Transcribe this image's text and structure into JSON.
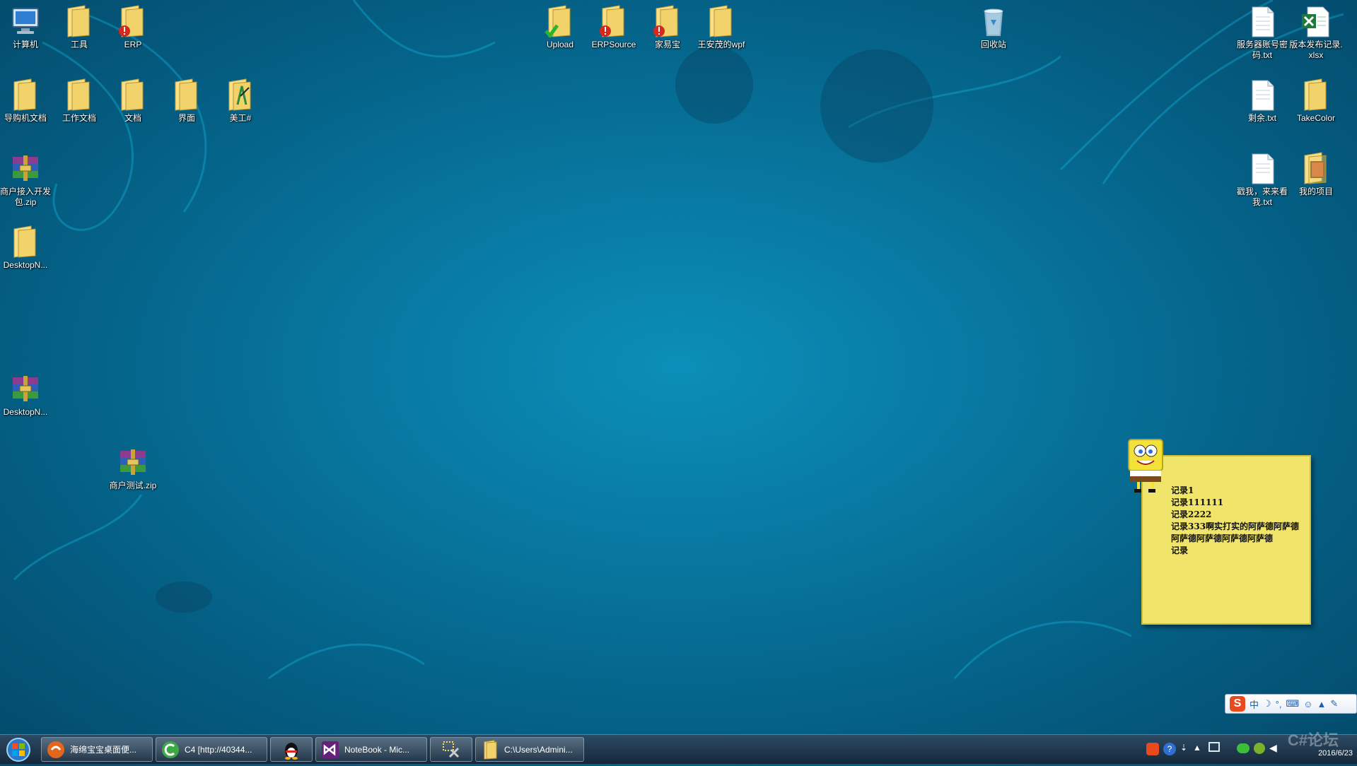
{
  "desktop": {
    "icons": [
      {
        "name": "icon-computer",
        "label": "计算机",
        "glyph": "computer-icon"
      },
      {
        "name": "icon-tools",
        "label": "工具",
        "glyph": "folder-icon"
      },
      {
        "name": "icon-erp",
        "label": "ERP",
        "glyph": "folder-error-icon"
      },
      {
        "name": "icon-upload",
        "label": "Upload",
        "glyph": "folder-check-icon"
      },
      {
        "name": "icon-erpsource",
        "label": "ERPSource",
        "glyph": "folder-error-icon"
      },
      {
        "name": "icon-jiayibao",
        "label": "家易宝",
        "glyph": "folder-error-icon"
      },
      {
        "name": "icon-wangmao-wpf",
        "label": "王安茂的wpf",
        "glyph": "folder-icon"
      },
      {
        "name": "icon-recycle-bin",
        "label": "回收站",
        "glyph": "recycle-bin-icon"
      },
      {
        "name": "icon-server-accounts",
        "label": "服务器账号密码.txt",
        "glyph": "text-file-icon"
      },
      {
        "name": "icon-release-log",
        "label": "版本发布记录.xlsx",
        "glyph": "excel-file-icon"
      },
      {
        "name": "icon-guide-docs",
        "label": "导购机文档",
        "glyph": "folder-icon"
      },
      {
        "name": "icon-work-docs",
        "label": "工作文档",
        "glyph": "folder-icon"
      },
      {
        "name": "icon-docs",
        "label": "文档",
        "glyph": "folder-icon"
      },
      {
        "name": "icon-ui",
        "label": "界面",
        "glyph": "folder-icon"
      },
      {
        "name": "icon-art",
        "label": "美工#",
        "glyph": "folder-art-icon"
      },
      {
        "name": "icon-remaining",
        "label": "剩余.txt",
        "glyph": "text-file-icon"
      },
      {
        "name": "icon-takecolor",
        "label": "TakeColor",
        "glyph": "folder-icon"
      },
      {
        "name": "icon-merchant-sdk",
        "label": "商户接入开发包.zip",
        "glyph": "archive-icon"
      },
      {
        "name": "icon-click-me",
        "label": "戳我，来来看我.txt",
        "glyph": "text-file-icon"
      },
      {
        "name": "icon-my-project",
        "label": "我的项目",
        "glyph": "folder-media-icon"
      },
      {
        "name": "icon-desktopn-folder",
        "label": "DesktopN...",
        "glyph": "folder-icon"
      },
      {
        "name": "icon-desktopn-archive",
        "label": "DesktopN...",
        "glyph": "archive-icon"
      },
      {
        "name": "icon-merchant-test",
        "label": "商户测试.zip",
        "glyph": "archive-icon"
      }
    ]
  },
  "sticky_note": {
    "lines": [
      "记录1",
      "记录111111",
      "记录2222",
      "记录333啊实打实的阿萨德阿萨德阿萨德阿萨德阿萨德阿萨德",
      "记录"
    ],
    "mascot": "spongebob-icon"
  },
  "ime_bar": {
    "logo": "S",
    "mode": "中",
    "icons": [
      "moon-icon",
      "punct-icon",
      "keyboard-icon",
      "user-icon",
      "shirt-icon",
      "wrench-icon"
    ]
  },
  "taskbar": {
    "start": "windows-start-icon",
    "buttons": [
      {
        "name": "task-sponge-notes",
        "label": "海绵宝宝桌面便...",
        "icon": "spongebob-app-icon"
      },
      {
        "name": "task-c4",
        "label": "C4 [http://40344...",
        "icon": "c4-icon"
      },
      {
        "name": "task-qq",
        "label": "",
        "icon": "qq-penguin-icon"
      },
      {
        "name": "task-visual-studio",
        "label": "NoteBook - Mic...",
        "icon": "visual-studio-icon"
      },
      {
        "name": "task-tool",
        "label": "",
        "icon": "tools-icon"
      },
      {
        "name": "task-explorer",
        "label": "C:\\Users\\Admini...",
        "icon": "folder-icon"
      }
    ],
    "clock_date": "2016/6/23",
    "watermark": "C#论坛"
  },
  "colors": {
    "desktop": "#087aa3",
    "note": "#f0e46a",
    "folder": "#f2d36b"
  }
}
